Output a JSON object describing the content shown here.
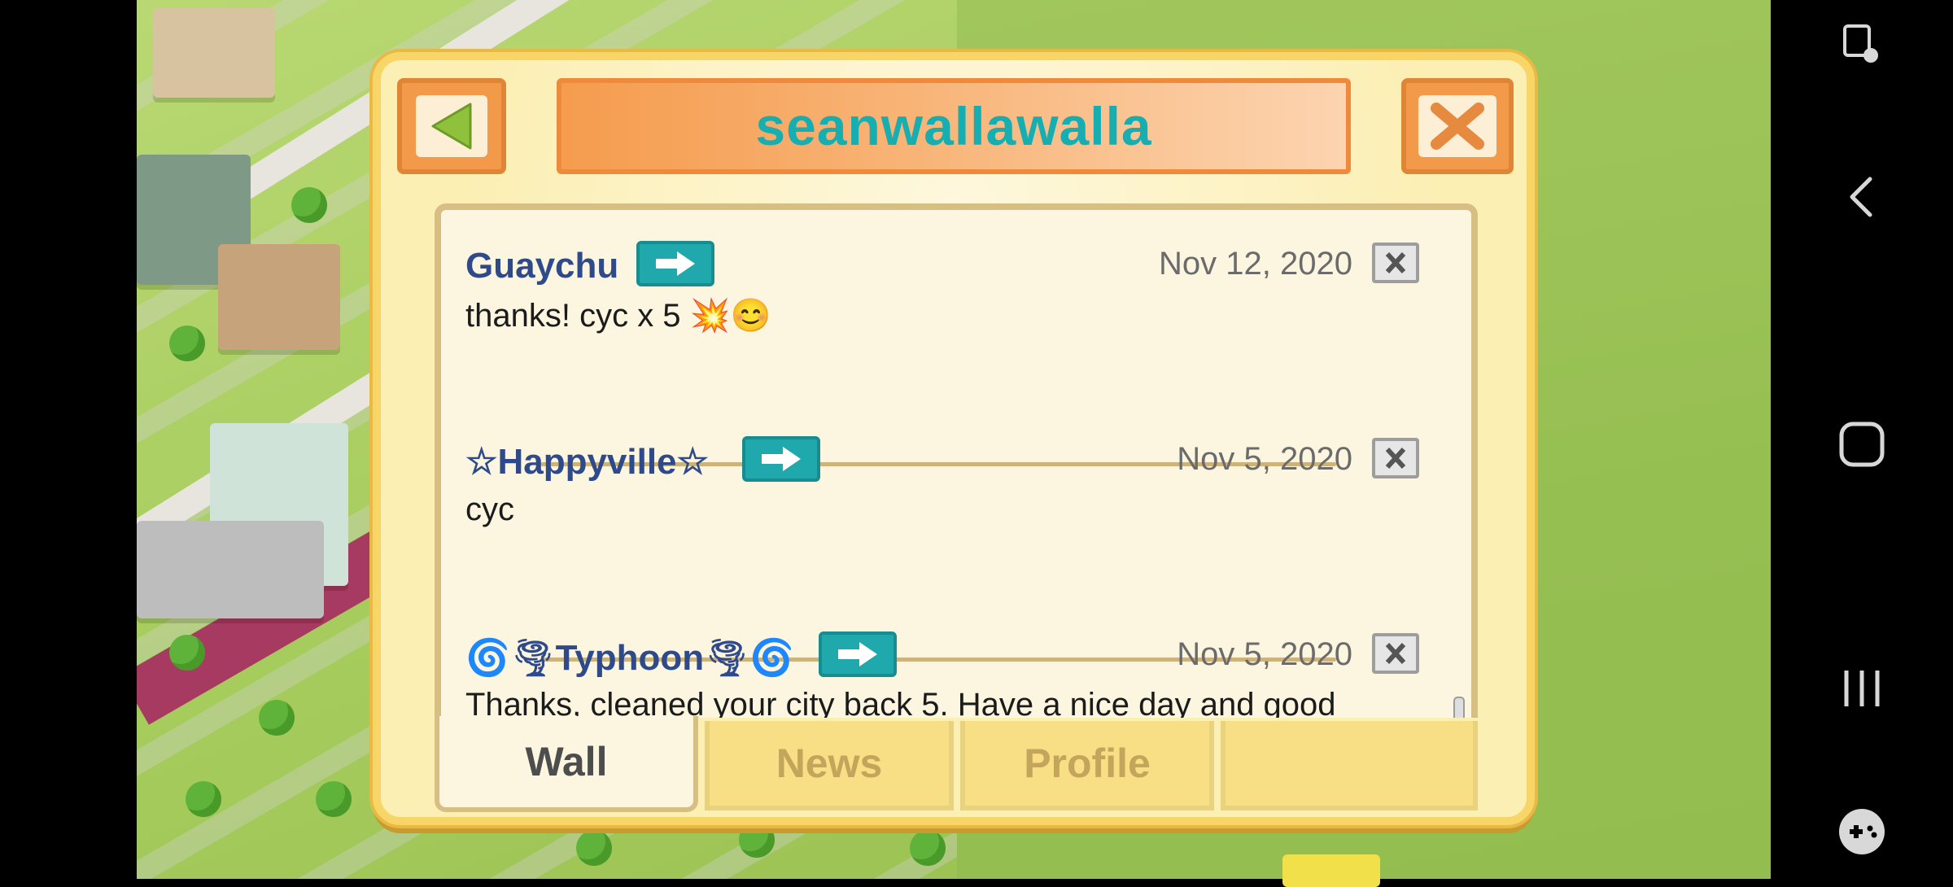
{
  "dialog": {
    "title": "seanwallawalla",
    "back_icon": "back-arrow-icon",
    "close_icon": "close-x-icon",
    "accent_color": "#17aeb2"
  },
  "wall": {
    "posts": [
      {
        "author": "Guaychu",
        "date": "Nov 12, 2020",
        "message": "thanks! cyc x 5 💥😊"
      },
      {
        "author": "☆Happyville☆",
        "date": "Nov 5, 2020",
        "message": "cyc"
      },
      {
        "author": "🌀🌪Typhoon🌪🌀",
        "date": "Nov 5, 2020",
        "message": "Thanks, cleaned your city back 5. Have a nice day and good"
      }
    ],
    "visit_icon": "arrow-right-icon",
    "delete_label": "X"
  },
  "tabs": [
    {
      "label": "Wall",
      "active": true
    },
    {
      "label": "News",
      "active": false
    },
    {
      "label": "Profile",
      "active": false
    },
    {
      "label": "",
      "active": false
    }
  ],
  "navbar": {
    "icons": [
      "screen-assist-icon",
      "nav-back-icon",
      "home-icon",
      "recents-icon",
      "game-tools-icon"
    ]
  }
}
